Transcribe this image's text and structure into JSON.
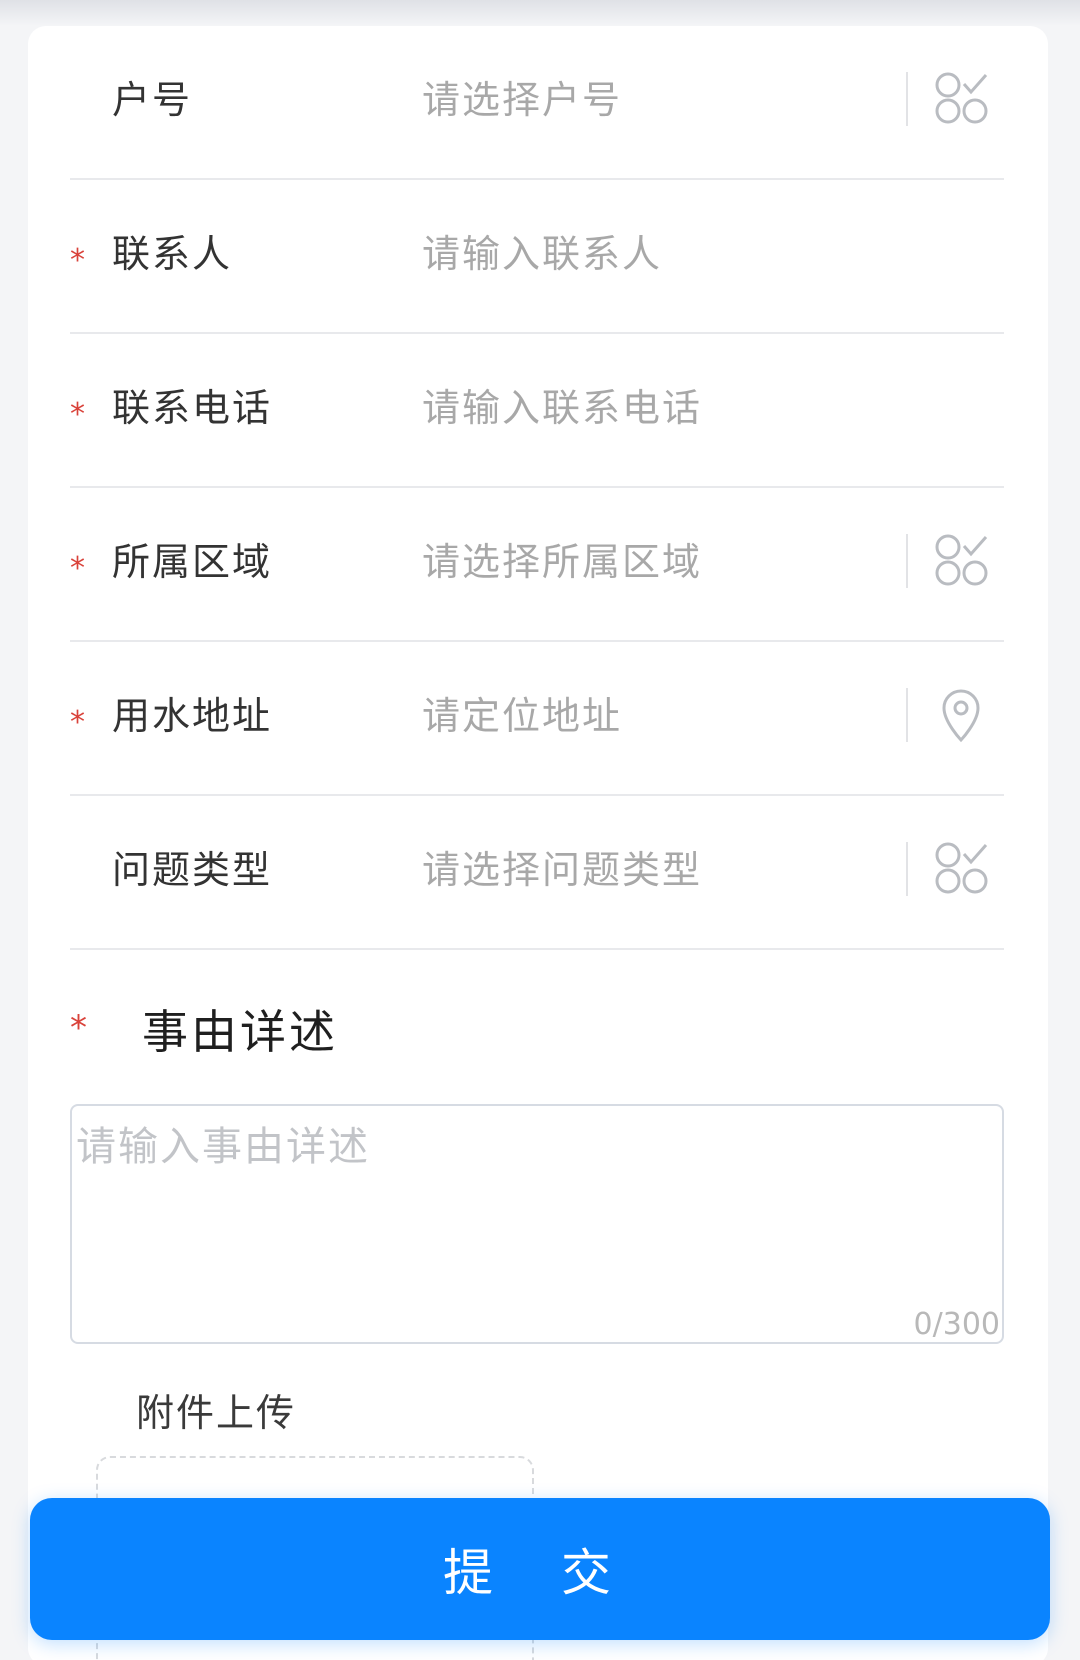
{
  "form": {
    "fields": [
      {
        "id": "account",
        "required": false,
        "label": "户号",
        "placeholder": "请选择户号",
        "icon": "select-list-icon"
      },
      {
        "id": "contact",
        "required": true,
        "label": "联系人",
        "placeholder": "请输入联系人",
        "icon": ""
      },
      {
        "id": "phone",
        "required": true,
        "label": "联系电话",
        "placeholder": "请输入联系电话",
        "icon": ""
      },
      {
        "id": "region",
        "required": true,
        "label": "所属区域",
        "placeholder": "请选择所属区域",
        "icon": "select-list-icon"
      },
      {
        "id": "address",
        "required": true,
        "label": "用水地址",
        "placeholder": "请定位地址",
        "icon": "location-pin-icon"
      },
      {
        "id": "issue_type",
        "required": false,
        "label": "问题类型",
        "placeholder": "请选择问题类型",
        "icon": "select-list-icon"
      }
    ],
    "required_mark": "*",
    "detail": {
      "label": "事由详述",
      "placeholder": "请输入事由详述",
      "counter": "0/300"
    },
    "upload": {
      "label": "附件上传"
    },
    "submit_label": "提 交"
  },
  "colors": {
    "accent": "#0a84ff",
    "required": "#d9423a",
    "placeholder": "#a8a8a8",
    "icon": "#b9bcc1"
  }
}
